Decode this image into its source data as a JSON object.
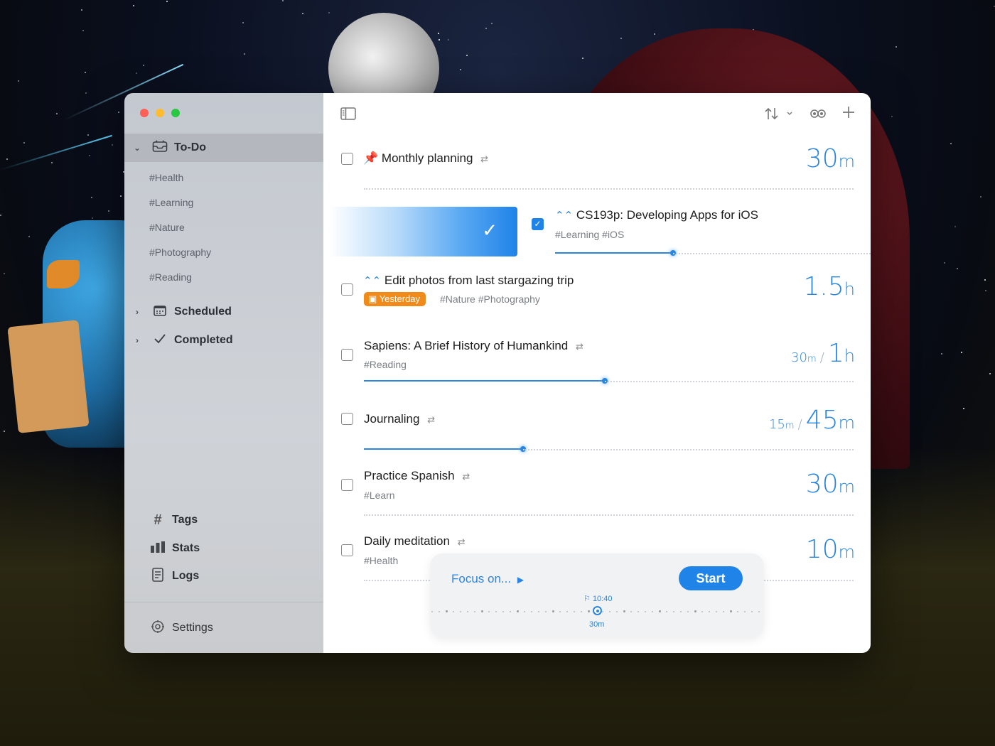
{
  "sidebar": {
    "todo_label": "To-Do",
    "tags": [
      "#Health",
      "#Learning",
      "#Nature",
      "#Photography",
      "#Reading"
    ],
    "scheduled_label": "Scheduled",
    "completed_label": "Completed",
    "bottom": {
      "tags_label": "Tags",
      "stats_label": "Stats",
      "logs_label": "Logs"
    },
    "settings_label": "Settings"
  },
  "colors": {
    "accent": "#1f83e8",
    "badge": "#f08a1a",
    "traffic_red": "#fe5f57",
    "traffic_yellow": "#febc2e",
    "traffic_green": "#28c840"
  },
  "icons": {
    "sidebar_toggle": "sidebar-toggle-icon",
    "sort": "sort-icon",
    "chevron": "chevron-down-icon",
    "view": "view-toggle-icon",
    "add": "plus-icon"
  },
  "tasks": [
    {
      "title": "Monthly planning",
      "pinned": true,
      "repeat": true,
      "duration_num": "30",
      "duration_unit": "m",
      "checked": false
    },
    {
      "title": "CS193p: Developing Apps for iOS",
      "priority": true,
      "tags": "#Learning  #iOS",
      "checked": true,
      "progress": 0.42
    },
    {
      "title": "Edit photos from last stargazing trip",
      "priority": true,
      "badge": "Yesterday",
      "tags": "#Nature #Photography",
      "duration_num": "1.5",
      "duration_unit": "h",
      "checked": false
    },
    {
      "title": "Sapiens: A Brief History of Humankind",
      "repeat": true,
      "tags": "#Reading",
      "done_num": "30",
      "done_unit": "m",
      "sep": "/",
      "duration_num": "1",
      "duration_unit": "h",
      "checked": false,
      "progress": 0.5
    },
    {
      "title": "Journaling",
      "repeat": true,
      "done_num": "15",
      "done_unit": "m",
      "sep": "/",
      "duration_num": "45",
      "duration_unit": "m",
      "checked": false,
      "progress": 0.33
    },
    {
      "title": "Practice Spanish",
      "repeat": true,
      "tags": "#Learn",
      "duration_num": "30",
      "duration_unit": "m",
      "checked": false
    },
    {
      "title": "Daily meditation",
      "repeat": true,
      "tags": "#Health",
      "duration_num": "10",
      "duration_unit": "m",
      "checked": false
    }
  ],
  "focus": {
    "label": "Focus on...",
    "start_label": "Start",
    "end_time": "10:40",
    "duration": "30m"
  }
}
